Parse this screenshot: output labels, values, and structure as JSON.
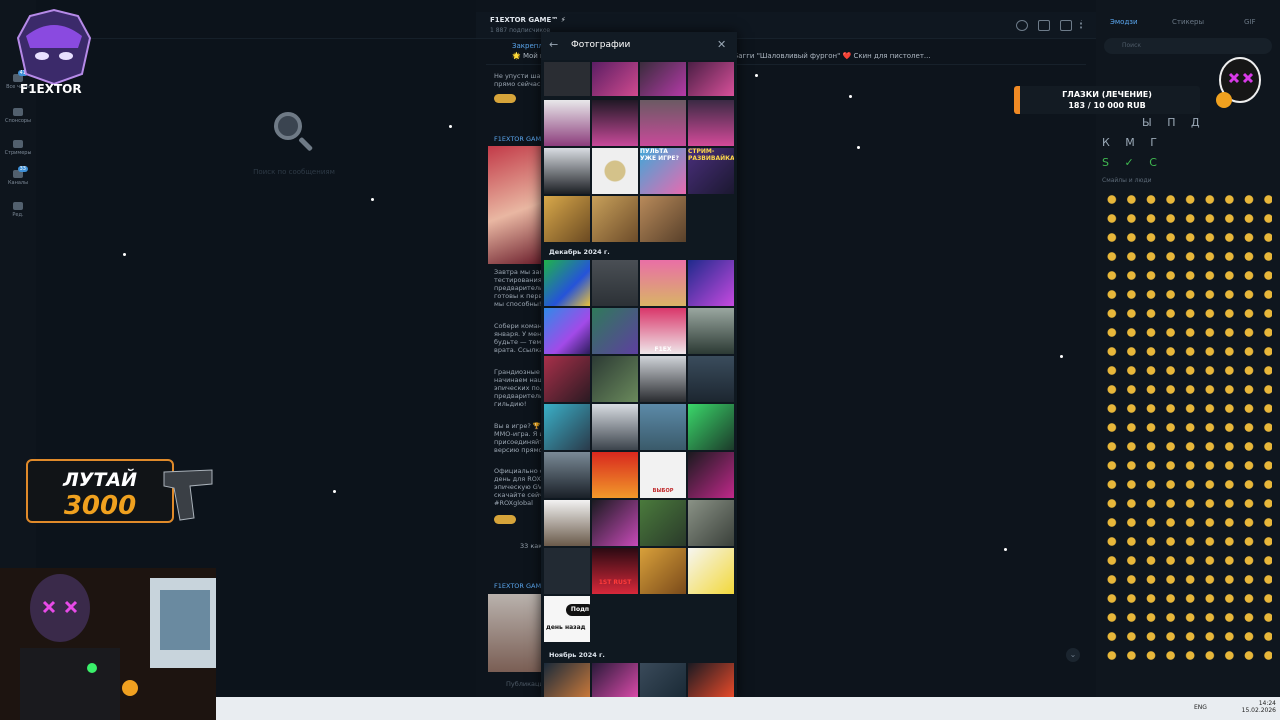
{
  "folders": [
    {
      "label": "Все чаты",
      "badge": "41"
    },
    {
      "label": "Спонсоры",
      "badge": ""
    },
    {
      "label": "Стримеры",
      "badge": ""
    },
    {
      "label": "Каналы",
      "badge": "33"
    },
    {
      "label": "Ред.",
      "badge": ""
    }
  ],
  "chatlist": {
    "empty_hint": "Поиск по сообщениям"
  },
  "channel": {
    "title": "F1EXTOR GAME™ ⚡",
    "subscribers": "1 887 подписчиков",
    "pinned_title": "Закрепл...",
    "pinned_text": "🌟 Мой к... в виде сердца для вашего оружия! ❤️ Скин для Багги \"Шаловливый фургон\" ❤️ Скин для пистолет...",
    "msg1": "Не упусти шан...\nпрямо сейчас и...",
    "post_author": "F1EXTOR GAM...",
    "msg2": "Завтра мы зап...\nтестирования г...\nпредварительн...\nготовы к перв...\nмы способны!",
    "msg3": "Собери коман...\nянваря. У мен...\nбудьте — тем...\nврата. Ссылка...",
    "msg4": "Грандиозные с...\nначинаем наш...\nэпических под...\nпредварительн...\nгильдию!",
    "msg5": "Вы в игре? 🏆\nMMO-игра. Я и...\nприсоединяйт...\nверсию прямо...",
    "msg6": "Официально ст...\nдень для ROX. Е...\nэпическую GVG...\nскачайте сейча...\n#ROXglobal",
    "post_author2": "F1EXTOR GAM...",
    "views": "33 како...",
    "compose": "Публикация..."
  },
  "modal": {
    "title": "Фотографии",
    "month_dec": "Декабрь 2024 г.",
    "month_nov": "Ноябрь 2024 г.",
    "tile_texts": {
      "stream": "СТРИМ-РАЗВИВАЙКА",
      "remote": "ПУЛЬТА УЖЕ ИГРЕ?",
      "f1ex": "F1EX",
      "rust": "1ST RUST SERV",
      "choice": "ВЫБОР МУЖЧИНЫ",
      "day": "день назад",
      "sub": "Подп"
    }
  },
  "emoji_panel": {
    "tabs": [
      "Эмодзи",
      "Стикеры",
      "GIF"
    ],
    "search_placeholder": "Поиск",
    "section": "Смайлы и люди",
    "letters_row1": "Ы П Д",
    "letters_row2": "К М Г",
    "letters_row3": "S ✓ C"
  },
  "overlay": {
    "logo_text": "F1EXTOR",
    "donation_goal": "ГЛАЗКИ (ЛЕЧЕНИЕ)",
    "donation_amount": "183 / 10 000 RUB",
    "loot_line1": "ЛУТАЙ",
    "loot_line2": "3000"
  },
  "taskbar": {
    "lang": "ENG",
    "time": "14:24",
    "date": "15.02.2026"
  },
  "colors": {
    "accent": "#5aa6ee",
    "orange": "#f08a24",
    "bg": "#0b121a"
  }
}
